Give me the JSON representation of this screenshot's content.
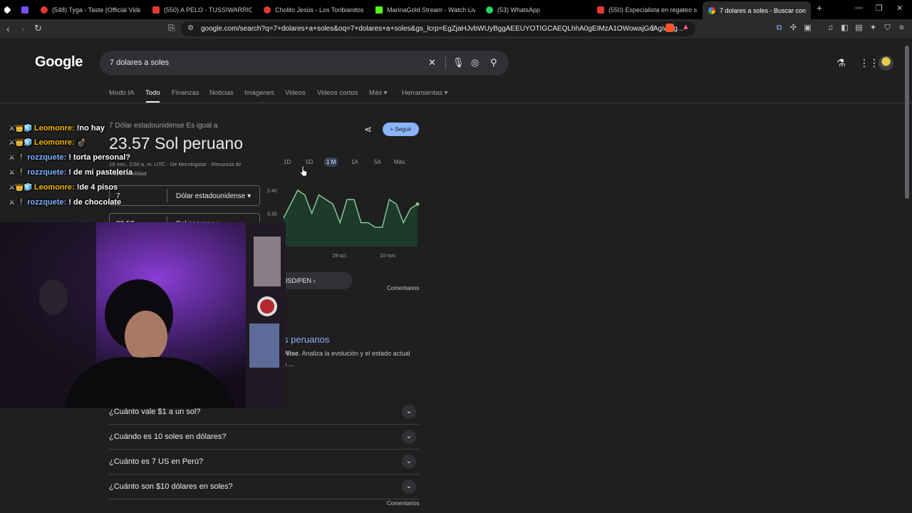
{
  "browser": {
    "tabs": [
      {
        "title": "",
        "color": "#ffffff"
      },
      {
        "title": "",
        "color": "#7c4dff"
      },
      {
        "title": "(548) Tyga - Taste (Official Video) ft",
        "color": "#e53935"
      },
      {
        "title": "(550) A PELO - TUSSIWARRIORS (V",
        "color": "#e53935"
      },
      {
        "title": "Cholito Jesús - Los Toribianitos - LI",
        "color": "#e53935"
      },
      {
        "title": "MarinaGold Stream - Watch Live o",
        "color": "#53fc18"
      },
      {
        "title": "(53) WhatsApp",
        "color": "#25d366"
      },
      {
        "title": "(550) Especialista en regateo se ni",
        "color": "#e53935"
      },
      {
        "title": "7 dolares a soles - Buscar con",
        "color": "#ffffff"
      }
    ],
    "url": "google.com/search?q=7+dolares+a+soles&oq=7+dolares+a+soles&gs_lcrp=EgZjaHJvbWUyBggAEEUYOTIGCAEQLhhA0gEIMzA1OWowajGoAgiwAg..."
  },
  "google": {
    "logo": "Google",
    "query": "7 dolares a soles",
    "nav": [
      "Modo IA",
      "Todo",
      "Finanzas",
      "Noticias",
      "Imágenes",
      "Videos",
      "Videos cortos",
      "Más ▾",
      "Herramientas ▾"
    ]
  },
  "converter": {
    "subtitle": "7 Dólar estadounidense Es igual a",
    "result": "23.57 Sol peruano",
    "meta": "19 nov., 2:00 a. m. UTC · De Morningstar · Renuncia de responsabilidad",
    "from_amount": "7",
    "from_currency": "Dólar estadounidense  ▾",
    "to_amount": "23.57",
    "to_currency": "Sol peruano  ▾",
    "follow_label": "+ Seguir",
    "ranges": [
      "1D",
      "5D",
      "1 M",
      "1A",
      "5A",
      "Máx."
    ],
    "active_range": "1 M",
    "pair_label": "USD/PEN  ›",
    "comments": "Comentarios"
  },
  "chart_data": {
    "type": "area",
    "y_ticks": [
      "3.40",
      "3.35"
    ],
    "x_ticks": [
      "29 oct.",
      "10 nov."
    ],
    "ylim": [
      3.28,
      3.42
    ],
    "values": [
      3.34,
      3.37,
      3.4,
      3.39,
      3.35,
      3.39,
      3.38,
      3.37,
      3.33,
      3.38,
      3.38,
      3.33,
      3.33,
      3.32,
      3.32,
      3.38,
      3.37,
      3.33,
      3.36,
      3.37
    ],
    "line_color": "#81c995",
    "fill_color": "#1e3a2b"
  },
  "result": {
    "title": "s peruanos",
    "snippet_bold": "Wise",
    "snippet": ". Analiza la evolución y el estado actual",
    "snippet2": "s ..."
  },
  "faqs": [
    "¿Cuánto vale $1 a un sol?",
    "¿Cuándo es 10 soles en dólares?",
    "¿Cuánto es 7 US en Perú?",
    "¿Cuánto son $10 dólares en soles?"
  ],
  "faq_comments": "Comentarios",
  "chat": [
    {
      "user": "Leomonre:",
      "msg": "!no hay",
      "color": "#f5b700",
      "badges": "⚔👑🧊"
    },
    {
      "user": "Leomonre:",
      "msg": "💣",
      "color": "#f5b700",
      "badges": "⚔👑🧊"
    },
    {
      "user": "rozzquete:",
      "msg": "! torta personal?",
      "color": "#7fb2ff",
      "badges": "⚔ 🕴"
    },
    {
      "user": "rozzquete:",
      "msg": "! de mi pastelería",
      "color": "#7fb2ff",
      "badges": "⚔ 🕴"
    },
    {
      "user": "Leomonre:",
      "msg": "!de 4 pisos",
      "color": "#f5b700",
      "badges": "⚔👑🧊"
    },
    {
      "user": "rozzquete:",
      "msg": "! de chocolate",
      "color": "#7fb2ff",
      "badges": "⚔ 🕴"
    }
  ]
}
